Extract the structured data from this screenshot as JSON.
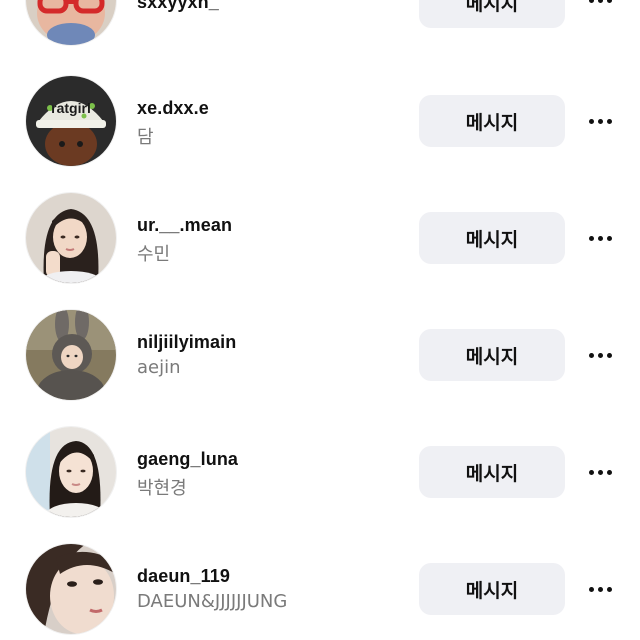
{
  "message_label": "메시지",
  "rows": [
    {
      "username": "sxxyyxn_",
      "subname": ""
    },
    {
      "username": "xe.dxx.e",
      "subname": "담"
    },
    {
      "username": "ur.__.mean",
      "subname": "수민"
    },
    {
      "username": "niljiilyimain",
      "subname": "aejin"
    },
    {
      "username": "gaeng_luna",
      "subname": "박현경"
    },
    {
      "username": "daeun_119",
      "subname": "DAEUN&JJJJJJUNG"
    }
  ],
  "avatars": [
    {
      "icon": "avatar-red-glasses-photo"
    },
    {
      "icon": "avatar-ratgirl-cap-photo",
      "cap_text": "ratgirl"
    },
    {
      "icon": "avatar-woman-photo"
    },
    {
      "icon": "avatar-bunny-costume-photo"
    },
    {
      "icon": "avatar-woman-selfie-photo"
    },
    {
      "icon": "avatar-woman-closeup-photo"
    }
  ],
  "colors": {
    "button_bg": "#eff0f4",
    "subname": "#7a7a7a",
    "text": "#111111"
  }
}
